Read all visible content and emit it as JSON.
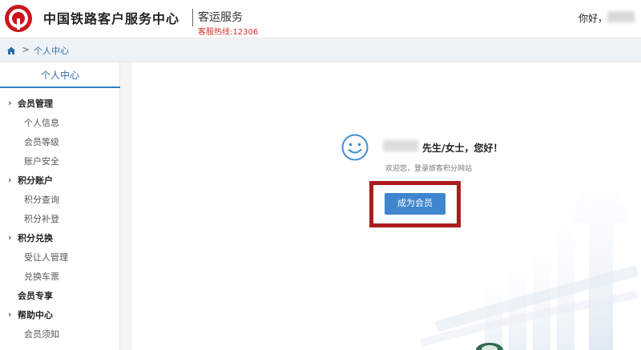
{
  "header": {
    "brand": "中国铁路客户服务中心",
    "subtitle": "客运服务",
    "hotline": "客服热线:12306",
    "greeting": "你好，"
  },
  "breadcrumb": {
    "separator": ">",
    "current": "个人中心"
  },
  "sidebar": {
    "title": "个人中心",
    "items": [
      {
        "label": "会员管理",
        "level": "group",
        "arrow": true
      },
      {
        "label": "个人信息",
        "level": "sub"
      },
      {
        "label": "会员等级",
        "level": "sub"
      },
      {
        "label": "账户安全",
        "level": "sub"
      },
      {
        "label": "积分账户",
        "level": "group",
        "arrow": true
      },
      {
        "label": "积分查询",
        "level": "sub"
      },
      {
        "label": "积分补登",
        "level": "sub"
      },
      {
        "label": "积分兑换",
        "level": "group",
        "arrow": true
      },
      {
        "label": "受让人管理",
        "level": "sub"
      },
      {
        "label": "兑换车票",
        "level": "sub"
      },
      {
        "label": "会员专享",
        "level": "group",
        "arrow": false
      },
      {
        "label": "帮助中心",
        "level": "group",
        "arrow": true
      },
      {
        "label": "会员须知",
        "level": "sub"
      }
    ]
  },
  "main": {
    "welcome": "先生/女士，您好！",
    "note": "欢迎您，登录旅客积分网站",
    "cta_label": "成为会员"
  },
  "colors": {
    "brand_red": "#c8161d",
    "primary_blue": "#3f86cf",
    "highlight_red": "#ad1c1f",
    "hotline_red": "#d8302f"
  }
}
